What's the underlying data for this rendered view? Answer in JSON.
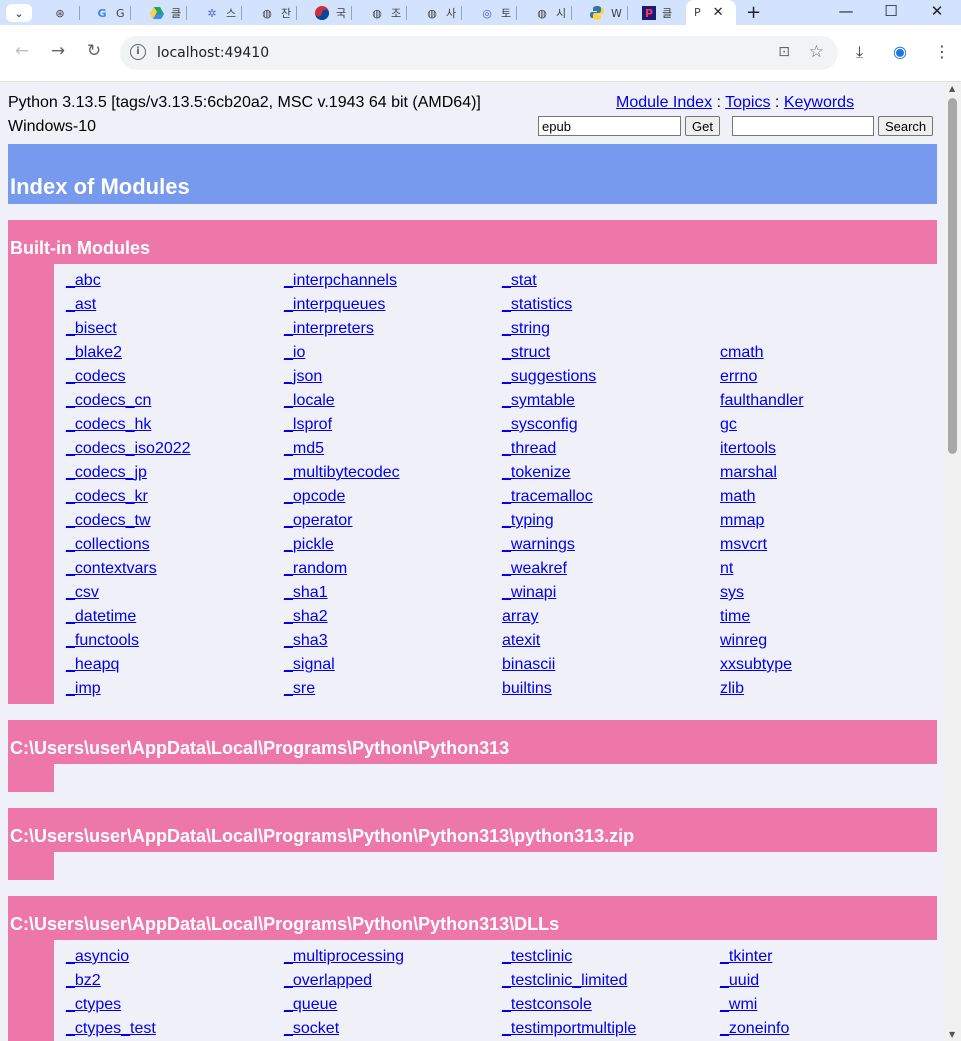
{
  "browser": {
    "tabs": [
      {
        "icon": "chatgpt-icon",
        "label": ""
      },
      {
        "icon": "google-icon",
        "label": "G"
      },
      {
        "icon": "drive-icon",
        "label": "클"
      },
      {
        "icon": "gear-icon",
        "label": "스"
      },
      {
        "icon": "globe-icon",
        "label": "잔"
      },
      {
        "icon": "taegeuk-icon",
        "label": "국"
      },
      {
        "icon": "globe-icon",
        "label": "조"
      },
      {
        "icon": "globe-icon",
        "label": "사"
      },
      {
        "icon": "fingerprint-icon",
        "label": "토"
      },
      {
        "icon": "globe-icon",
        "label": "시"
      },
      {
        "icon": "python-icon",
        "label": "W"
      },
      {
        "icon": "p-logo-icon",
        "label": "클"
      },
      {
        "icon": "",
        "label": "P"
      }
    ],
    "url": "localhost:49410"
  },
  "header": {
    "python_version": "Python 3.13.5 [tags/v3.13.5:6cb20a2, MSC v.1943 64 bit (AMD64)]",
    "os": "Windows-10",
    "links": {
      "module_index": "Module Index",
      "sep1": " : ",
      "topics": "Topics",
      "sep2": " : ",
      "keywords": "Keywords"
    },
    "get_value": "epub",
    "get_button": "Get",
    "search_value": "",
    "search_button": "Search"
  },
  "index_title": "Index of Modules",
  "sections": {
    "builtin": {
      "title": "Built-in Modules",
      "columns": [
        [
          "_abc",
          "_ast",
          "_bisect",
          "_blake2",
          "_codecs",
          "_codecs_cn",
          "_codecs_hk",
          "_codecs_iso2022",
          "_codecs_jp",
          "_codecs_kr",
          "_codecs_tw",
          "_collections",
          "_contextvars",
          "_csv",
          "_datetime",
          "_functools",
          "_heapq",
          "_imp"
        ],
        [
          "_interpchannels",
          "_interpqueues",
          "_interpreters",
          "_io",
          "_json",
          "_locale",
          "_lsprof",
          "_md5",
          "_multibytecodec",
          "_opcode",
          "_operator",
          "_pickle",
          "_random",
          "_sha1",
          "_sha2",
          "_sha3",
          "_signal",
          "_sre"
        ],
        [
          "_stat",
          "_statistics",
          "_string",
          "_struct",
          "_suggestions",
          "_symtable",
          "_sysconfig",
          "_thread",
          "_tokenize",
          "_tracemalloc",
          "_typing",
          "_warnings",
          "_weakref",
          "_winapi",
          "array",
          "atexit",
          "binascii",
          "builtins"
        ],
        [
          "cmath",
          "errno",
          "faulthandler",
          "gc",
          "itertools",
          "marshal",
          "math",
          "mmap",
          "msvcrt",
          "nt",
          "sys",
          "time",
          "winreg",
          "xxsubtype",
          "zlib"
        ]
      ]
    },
    "python313": {
      "title": "C:\\Users\\user\\AppData\\Local\\Programs\\Python\\Python313"
    },
    "python313_zip": {
      "title": "C:\\Users\\user\\AppData\\Local\\Programs\\Python\\Python313\\python313.zip"
    },
    "dlls": {
      "title": "C:\\Users\\user\\AppData\\Local\\Programs\\Python\\Python313\\DLLs",
      "columns": [
        [
          "_asyncio",
          "_bz2",
          "_ctypes",
          "_ctypes_test"
        ],
        [
          "_multiprocessing",
          "_overlapped",
          "_queue",
          "_socket"
        ],
        [
          "_testclinic",
          "_testclinic_limited",
          "_testconsole",
          "_testimportmultiple"
        ],
        [
          "_tkinter",
          "_uuid",
          "_wmi",
          "_zoneinfo"
        ]
      ]
    }
  }
}
